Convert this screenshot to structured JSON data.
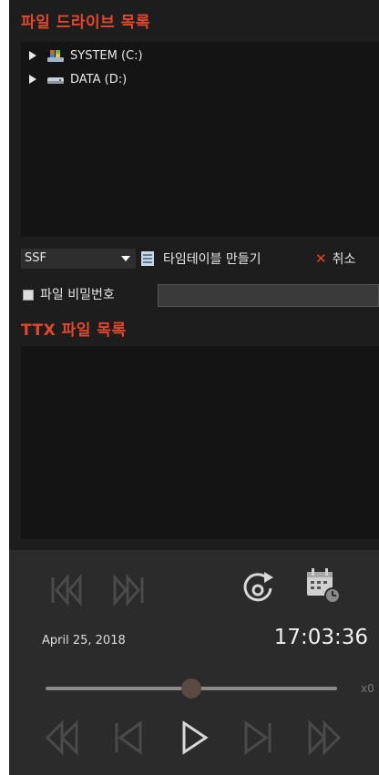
{
  "drive_list": {
    "title": "파일 드라이브 목록",
    "items": [
      {
        "label": "SYSTEM (C:)",
        "icon": "system-drive-icon"
      },
      {
        "label": "DATA (D:)",
        "icon": "hard-drive-icon"
      }
    ]
  },
  "toolbar": {
    "format_selected": "SSF",
    "make_timetable_label": "타임테이블 만들기",
    "cancel_label": "취소"
  },
  "password": {
    "checkbox_label": "파일 비밀번호",
    "checked": false,
    "value": ""
  },
  "ttx_list": {
    "title": "TTX 파일 목록",
    "items": []
  },
  "player": {
    "date": "April 25, 2018",
    "time": "17:03:36",
    "speed_label": "x0",
    "slider_fraction": 0.5
  },
  "colors": {
    "accent": "#e0472b",
    "background": "#1d1d1d",
    "panel": "#141414",
    "player_bg": "#2b2b2b",
    "icon_dim": "#4a4a4a"
  }
}
